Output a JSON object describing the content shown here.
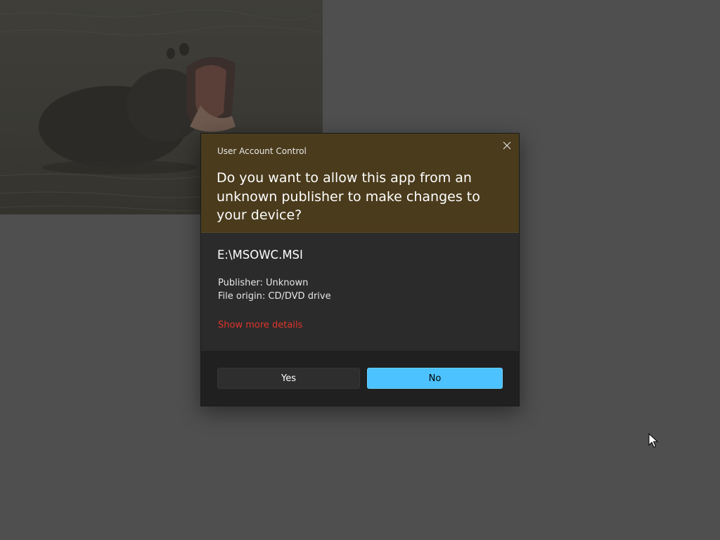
{
  "dialog": {
    "title": "User Account Control",
    "question": "Do you want to allow this app from an unknown publisher to make changes to your device?",
    "app_name": "E:\\MSOWC.MSI",
    "publisher": "Publisher: Unknown",
    "file_origin": "File origin: CD/DVD drive",
    "details_link": "Show more details",
    "yes_label": "Yes",
    "no_label": "No",
    "close_icon": "close-icon"
  },
  "colors": {
    "header_bg": "#4a3b1c",
    "body_bg": "#2b2b2b",
    "footer_bg": "#202020",
    "link": "#e0352b",
    "primary_button": "#4cc2ff",
    "desktop_dim": "#4f4f4f"
  },
  "background": {
    "image": "hippo-photo-dimmed"
  }
}
